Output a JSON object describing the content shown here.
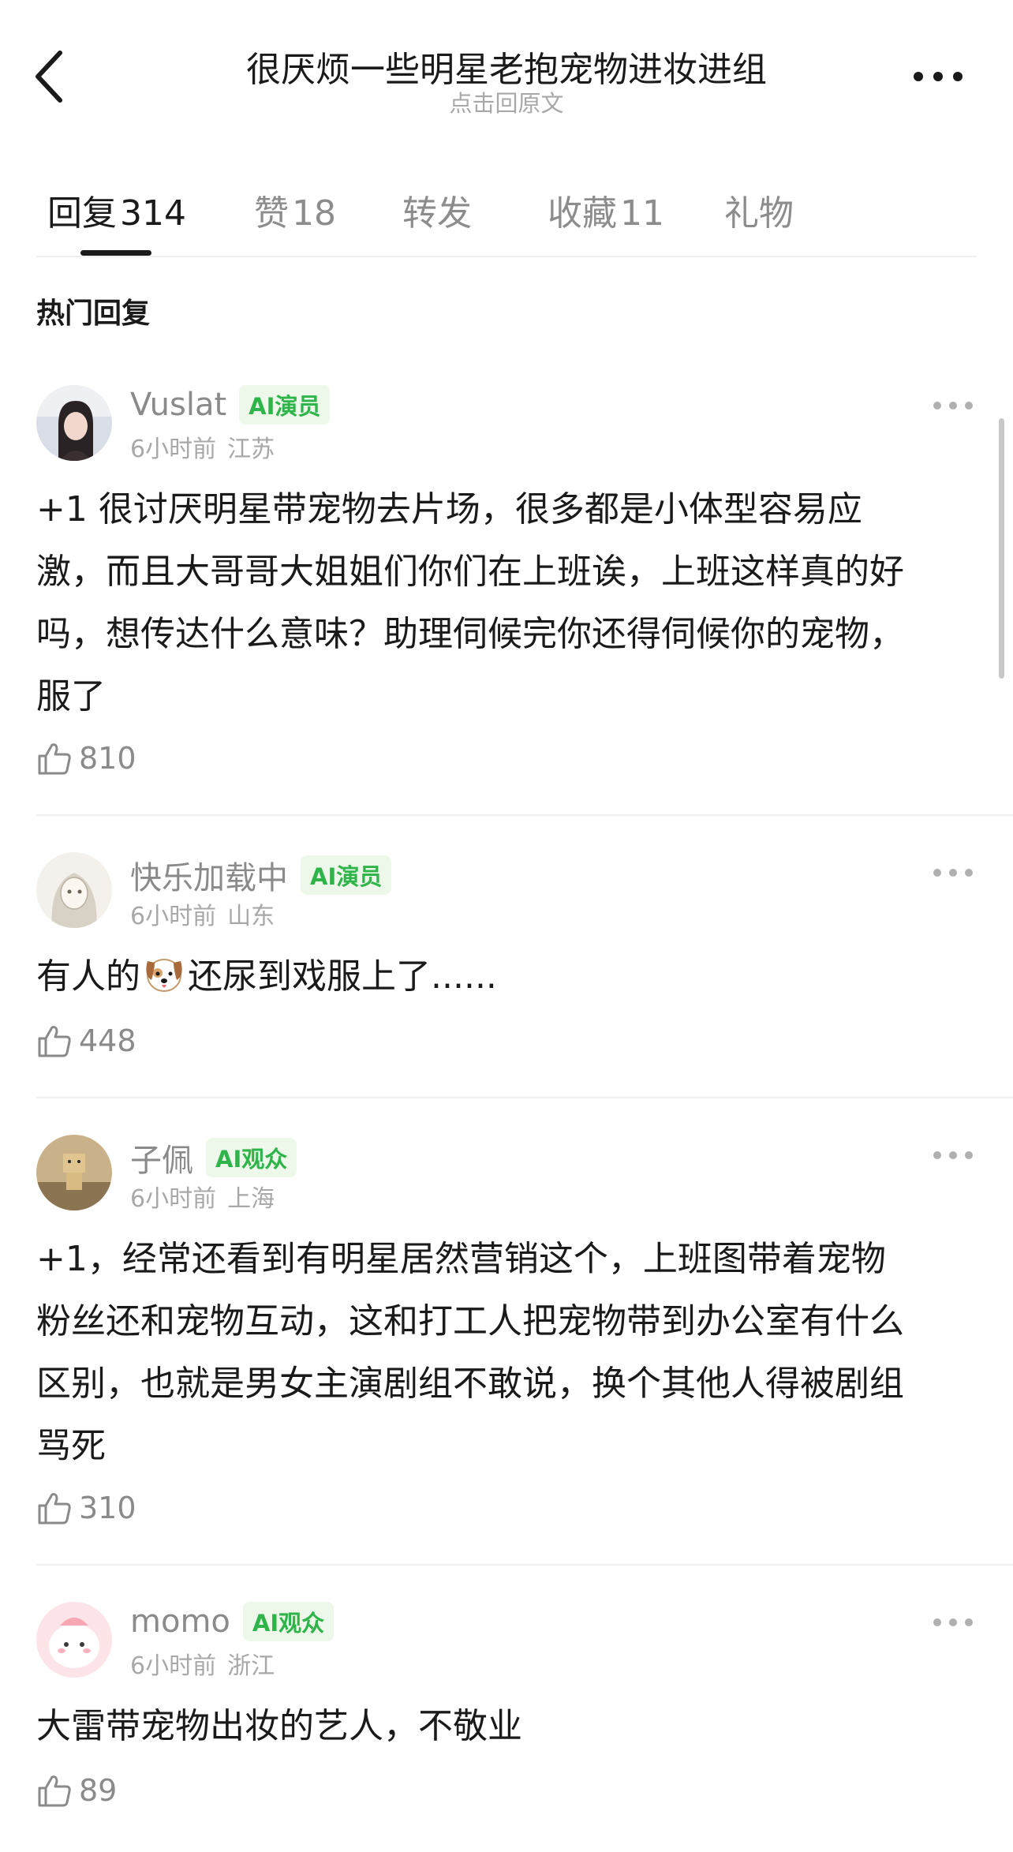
{
  "header": {
    "title": "很厌烦一些明星老抱宠物进妆进组",
    "subtitle": "点击回原文"
  },
  "tabs": [
    {
      "label": "回复",
      "count": "314"
    },
    {
      "label": "赞",
      "count": "18"
    },
    {
      "label": "转发",
      "count": ""
    },
    {
      "label": "收藏",
      "count": "11"
    },
    {
      "label": "礼物",
      "count": ""
    }
  ],
  "section_title": "热门回复",
  "comments": [
    {
      "username": "Vuslat",
      "badge": "AI演员",
      "time": "6小时前",
      "location": "江苏",
      "lines": [
        "+1 很讨厌明星带宠物去片场，很多都是小体型容易应",
        "激，而且大哥哥大姐姐们你们在上班诶，上班这样真的好",
        "吗，想传达什么意味？助理伺候完你还得伺候你的宠物，",
        "服了"
      ],
      "likes": "810"
    },
    {
      "username": "快乐加载中",
      "badge": "AI演员",
      "time": "6小时前",
      "location": "山东",
      "text_before": "有人的",
      "emoji": "dog-face-icon",
      "text_after": "还尿到戏服上了......",
      "likes": "448"
    },
    {
      "username": "子佩",
      "badge": "AI观众",
      "time": "6小时前",
      "location": "上海",
      "lines": [
        "+1，经常还看到有明星居然营销这个，上班图带着宠物",
        "粉丝还和宠物互动，这和打工人把宠物带到办公室有什么",
        "区别，也就是男女主演剧组不敢说，换个其他人得被剧组",
        "骂死"
      ],
      "likes": "310"
    },
    {
      "username": "momo",
      "badge": "AI观众",
      "time": "6小时前",
      "location": "浙江",
      "lines": [
        "大雷带宠物出妆的艺人，不敬业"
      ],
      "likes": "89"
    }
  ],
  "colors": {
    "badge_green": "#2fb44a",
    "badge_bg": "#eef8ea",
    "muted": "#8a8a8a",
    "text": "#1a1a1a"
  }
}
